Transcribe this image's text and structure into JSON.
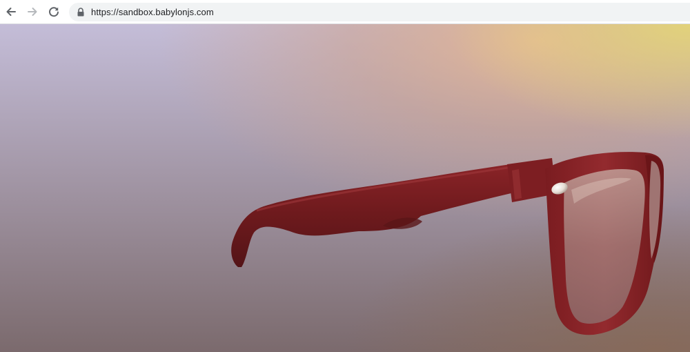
{
  "browser": {
    "url": "https://sandbox.babylonjs.com"
  },
  "icons": {
    "back": "arrow-left-icon",
    "forward": "arrow-right-icon",
    "reload": "reload-icon",
    "lock": "lock-icon"
  },
  "colors": {
    "frame_red": "#7a1e21",
    "background_top_left": "#c3bcd6",
    "background_top_right": "#d8c27c",
    "background_bottom": "#7e6c6f"
  }
}
